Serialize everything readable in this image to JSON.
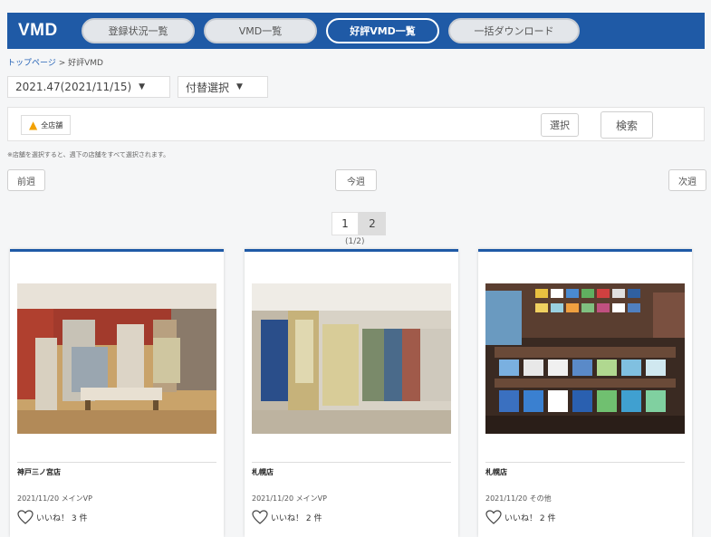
{
  "header": {
    "brand": "VMD",
    "nav": [
      {
        "label": "登録状況一覧",
        "active": false
      },
      {
        "label": "VMD一覧",
        "active": false
      },
      {
        "label": "好評VMD一覧",
        "active": true
      },
      {
        "label": "一括ダウンロード",
        "active": false
      }
    ]
  },
  "breadcrumb": {
    "home": "トップページ",
    "sep": " > ",
    "current": "好評VMD"
  },
  "filters": {
    "week_select": "2021.47(2021/11/15)",
    "dept_select": "付替選択",
    "chip_label": "全店舗",
    "select_button": "選択",
    "search_button": "検索",
    "note": "※店舗を選択すると、週下の店舗をすべて選択されます。"
  },
  "week_nav": {
    "prev": "前週",
    "current": "今週",
    "next": "次週"
  },
  "pagination": {
    "pages": [
      "1",
      "2"
    ],
    "current": "1",
    "count": "(1/2)"
  },
  "cards": [
    {
      "store": "神戸三ノ宮店",
      "date": "2021/11/20 メインVP",
      "like_label": "いいね！",
      "like_count": "3 件"
    },
    {
      "store": "札幌店",
      "date": "2021/11/20 メインVP",
      "like_label": "いいね！",
      "like_count": "2 件"
    },
    {
      "store": "札幌店",
      "date": "2021/11/20 その他",
      "like_label": "いいね！",
      "like_count": "2 件"
    }
  ],
  "colors": {
    "primary": "#1f5aa6"
  }
}
